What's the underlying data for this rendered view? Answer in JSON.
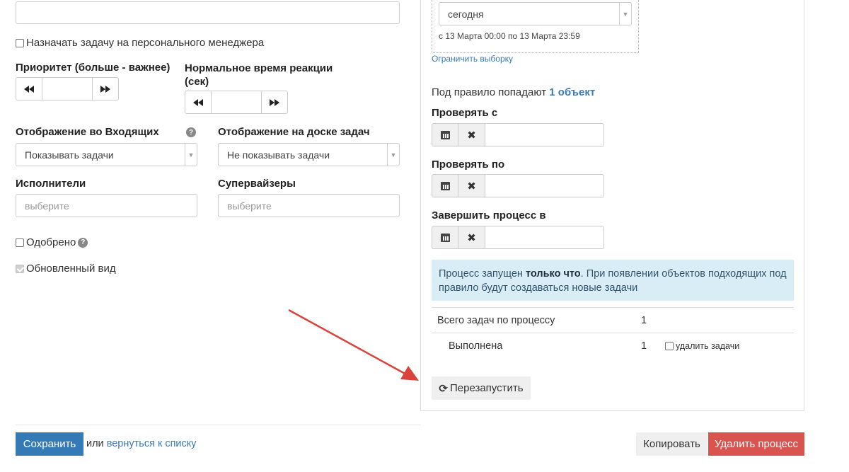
{
  "left": {
    "assign_manager_label": "Назначать задачу на персонального менеджера",
    "priority_label": "Приоритет (больше - важнее)",
    "reaction_label_line1": "Нормальное время реакции",
    "reaction_label_line2": "(сек)",
    "inbox_display_label": "Отображение во Входящих",
    "inbox_display_value": "Показывать задачи",
    "board_display_label": "Отображение на доске задач",
    "board_display_value": "Не показывать задачи",
    "executors_label": "Исполнители",
    "executors_placeholder": "выберите",
    "supervisors_label": "Супервайзеры",
    "supervisors_placeholder": "выберите",
    "approved_label": "Одобрено",
    "updated_view_label": "Обновленный вид"
  },
  "right": {
    "period_value": "сегодня",
    "period_range": "с 13 Марта 00:00 по 13 Марта 23:59",
    "limit_selection_link": "Ограничить выборку",
    "rule_count_prefix": "Под правило попадают",
    "rule_count_link": "1 объект",
    "check_from_label": "Проверять с",
    "check_to_label": "Проверять по",
    "finish_label": "Завершить процесс в",
    "info_prefix": "Процесс запущен",
    "info_bold": "только что",
    "info_suffix_line1": ". При появлении объектов подходящих под",
    "info_line2": "правило будут создаваться новые задачи",
    "total_tasks_label": "Всего задач по процессу",
    "total_tasks_count": "1",
    "done_label": "Выполнена",
    "done_count": "1",
    "delete_tasks_label": "удалить задачи",
    "restart_button": "Перезапустить"
  },
  "footer": {
    "save_button": "Сохранить",
    "or_text": "или",
    "back_link": "вернуться к списку",
    "copy_button": "Копировать",
    "delete_button": "Удалить процесс"
  },
  "colors": {
    "primary": "#337ab7",
    "danger": "#d9534f",
    "info_bg": "#d9edf7",
    "annotation_arrow": "#d9433a"
  }
}
